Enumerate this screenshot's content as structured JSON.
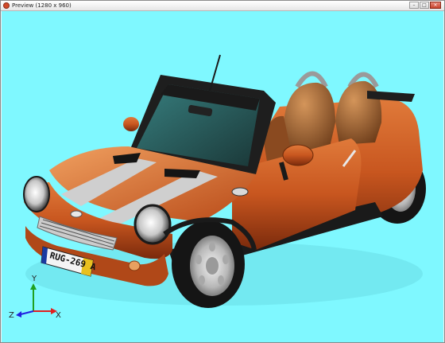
{
  "window": {
    "title": "Preview (1280 x 960)",
    "buttons": {
      "minimize": "–",
      "maximize": "□",
      "close": "×"
    }
  },
  "viewport": {
    "background_color": "#7ff8ff",
    "model": {
      "name": "orange convertible car",
      "body_color": "#c8561f",
      "license_plate": "RUG-269 A"
    },
    "axis_gizmo": {
      "x_label": "X",
      "y_label": "Y",
      "z_label": "Z",
      "x_color": "#e02020",
      "y_color": "#20a020",
      "z_color": "#2020e0"
    }
  }
}
